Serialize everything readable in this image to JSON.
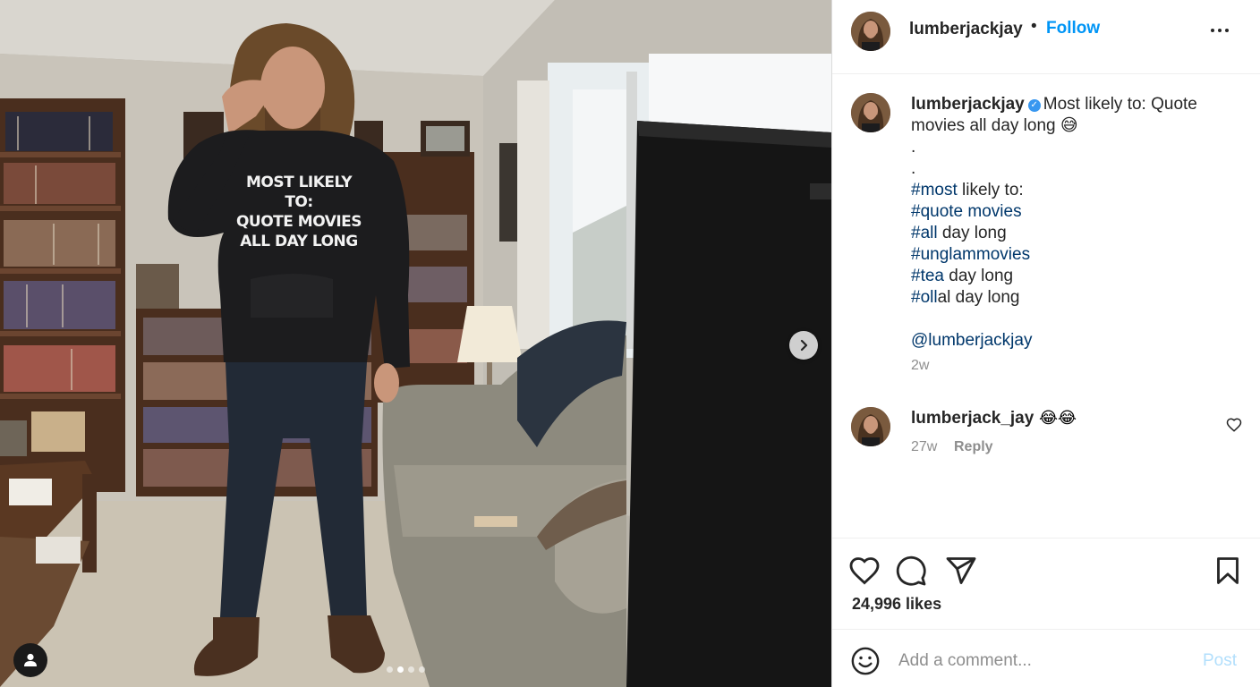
{
  "post": {
    "username": "lumberjackjay",
    "follow_dot": "•",
    "follow_label": "Follow"
  },
  "photo": {
    "hoodie_text": [
      "MOST LIKELY TO:",
      "QUOTE MOVIES",
      "ALL DAY LONG"
    ],
    "carousel_dots": 4,
    "active_dot": 1
  },
  "caption": {
    "username": "lumberjackjay",
    "verified_mark": "✓",
    "text_1": "Most likely to: Quote",
    "text_2": "movies all day long 😅",
    "dot_1": ".",
    "dot_2": ".",
    "hashtags": [
      {
        "tag": "#most",
        "rest": " likely to:"
      },
      {
        "tag": "#quote movies",
        "rest": ""
      },
      {
        "tag": "#all",
        "rest": " day long"
      },
      {
        "tag": "#unglammovies",
        "rest": ""
      },
      {
        "tag": "#tea",
        "rest": " day long"
      },
      {
        "tag": "#oll",
        "rest": "al day long"
      }
    ],
    "mention": "@lumberjackjay",
    "time": "2w"
  },
  "comment": {
    "username": "lumberjack_jay",
    "text": "😂😂",
    "time": "27w",
    "reply_label": "Reply"
  },
  "actions": {
    "likes": "24,996 likes"
  },
  "add_comment": {
    "placeholder": "Add a comment...",
    "post_label": "Post"
  },
  "colors": {
    "accent": "#0095f6",
    "link": "#00376b",
    "muted": "#8e8e8e",
    "post_disabled": "#b2dffc"
  },
  "icons": [
    "more-icon",
    "verified-icon",
    "heart-icon",
    "comment-icon",
    "share-icon",
    "bookmark-icon",
    "emoji-icon",
    "chevron-right-icon",
    "user-tag-icon"
  ]
}
